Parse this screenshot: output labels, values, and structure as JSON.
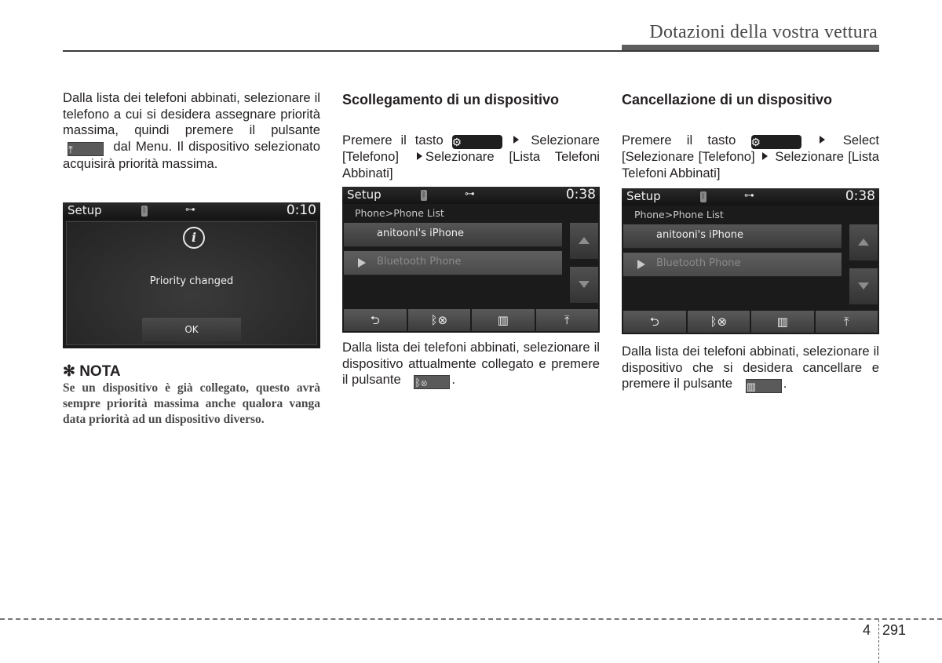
{
  "header": {
    "title": "Dotazioni della vostra vettura"
  },
  "column1": {
    "paragraph": {
      "before_button": "Dalla lista dei telefoni abbinati, selezionare il telefono a cui si desidera assegnare priorità massima, quindi premere il pulsante",
      "button_icon": "priority-icon",
      "after_button": "dal Menu. Il dispositivo selezionato acquisirà priorità massima."
    },
    "screen": {
      "title": "Setup",
      "clock": "0:10",
      "status_icons": [
        "bluetooth-icon",
        "usb-icon"
      ],
      "popup_icon": "info-icon",
      "popup_icon_glyph": "i",
      "message": "Priority changed",
      "ok_label": "OK"
    },
    "nota": {
      "heading_symbol": "✻",
      "heading": "NOTA",
      "text": "Se un dispositivo è già collegato, questo avrà sempre priorità massima anche qualora vanga data priorità ad un dispositivo diverso."
    }
  },
  "column2": {
    "heading": "Scollegamento di un dispositivo",
    "instruction": {
      "part1": "Premere il tasto",
      "key_icon": "gear-icon",
      "part2": "Selezionare [Telefono]",
      "part3": "Selezionare [Lista Telefoni Abbinati]"
    },
    "screen": {
      "title": "Setup",
      "clock": "0:38",
      "breadcrumb": "Phone>Phone List",
      "items": [
        {
          "label": "anitooni's iPhone",
          "selected": false
        },
        {
          "label": "Bluetooth Phone",
          "selected": true
        }
      ],
      "bottom_buttons": [
        "back-icon",
        "bluetooth-disconnect-icon",
        "trash-icon",
        "priority-icon"
      ]
    },
    "paragraph": {
      "before_button": "Dalla lista dei telefoni abbinati, selezionare il dispositivo attualmente collegato e premere il pulsante",
      "button_icon": "bluetooth-disconnect-icon",
      "after_button": "."
    }
  },
  "column3": {
    "heading": "Cancellazione di un dispositivo",
    "instruction": {
      "part1": "Premere il tasto",
      "key_icon": "gear-icon",
      "part2": "Select [Selezionare [Telefono]",
      "part3": "Selezionare [Lista Telefoni Abbinati]"
    },
    "screen": {
      "title": "Setup",
      "clock": "0:38",
      "breadcrumb": "Phone>Phone List",
      "items": [
        {
          "label": "anitooni's iPhone",
          "selected": false
        },
        {
          "label": "Bluetooth Phone",
          "selected": true
        }
      ],
      "bottom_buttons": [
        "back-icon",
        "bluetooth-disconnect-icon",
        "trash-icon",
        "priority-icon"
      ]
    },
    "paragraph": {
      "before_button": "Dalla lista dei telefoni abbinati, selezionare il dispositivo che si desidera cancellare e premere il pulsante",
      "button_icon": "trash-icon",
      "after_button": "."
    }
  },
  "footer": {
    "chapter": "4",
    "page": "291"
  },
  "glyphs": {
    "gear": "✿",
    "back": "⮌",
    "bt_disc": "✻⊗",
    "trash": "🗑",
    "priority": "⤒",
    "bt": "ᛒ",
    "usb": "⟞⊷"
  }
}
